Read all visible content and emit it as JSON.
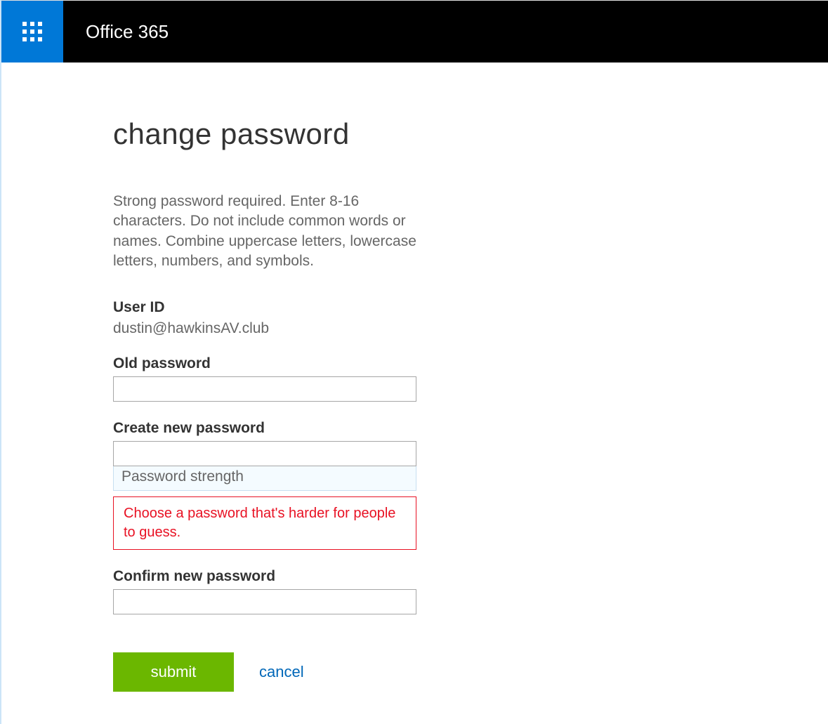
{
  "topbar": {
    "brand": "Office 365"
  },
  "page": {
    "title": "change password",
    "instructions": "Strong password required. Enter 8-16 characters. Do not include common words or names. Combine uppercase letters, lowercase letters, numbers, and symbols."
  },
  "form": {
    "user_id_label": "User ID",
    "user_id_value": "dustin@hawkinsAV.club",
    "old_password_label": "Old password",
    "old_password_value": "",
    "new_password_label": "Create new password",
    "new_password_value": "",
    "strength_label": "Password strength",
    "error_message": "Choose a password that's harder for people to guess.",
    "confirm_password_label": "Confirm new password",
    "confirm_password_value": "",
    "submit_label": "submit",
    "cancel_label": "cancel"
  }
}
